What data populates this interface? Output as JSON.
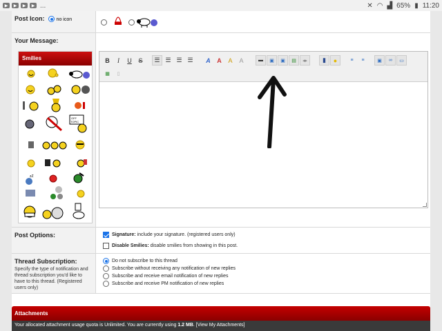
{
  "statusbar": {
    "dots": "...",
    "battery": "65%",
    "time": "11:20"
  },
  "post_icon": {
    "label": "Post Icon:",
    "no_icon_label": "no icon"
  },
  "message": {
    "label": "Your Message:"
  },
  "smilies": {
    "title": "Smilies"
  },
  "toolbar": {
    "bold": "B",
    "italic": "I",
    "underline": "U",
    "strike": "S",
    "icons": [
      "align-left-icon",
      "align-center-icon",
      "align-right-icon",
      "align-justify-icon",
      "font-icon",
      "font-size-icon",
      "text-color-icon",
      "highlight-icon",
      "insert-image-icon",
      "insert-image-2-icon",
      "insert-link-image-icon",
      "video-icon",
      "code-icon",
      "quote-icon",
      "smiley-icon",
      "bullet-list-icon",
      "numbered-list-icon",
      "paste-icon",
      "link-icon",
      "comment-icon",
      "more-icon",
      "source-icon"
    ]
  },
  "post_options": {
    "label": "Post Options:",
    "signature_bold": "Signature:",
    "signature_text": "include your signature. (registered users only)",
    "disable_bold": "Disable Smilies:",
    "disable_text": "disable smilies from showing in this post."
  },
  "subscription": {
    "label": "Thread Subscription:",
    "help": "Specify the type of notification and thread subscription you'd like to have to this thread. (Registered users only)",
    "options": [
      "Do not subscribe to this thread",
      "Subscribe without receiving any notification of new replies",
      "Subscribe and receive email notification of new replies",
      "Subscribe and receive PM notification of new replies"
    ]
  },
  "attachments": {
    "title": "Attachments",
    "info_prefix": "Your allocated attachment usage quota is Unlimited. You are currently using",
    "usage": "1.2 MB",
    "link": "[View My Attachments]"
  }
}
